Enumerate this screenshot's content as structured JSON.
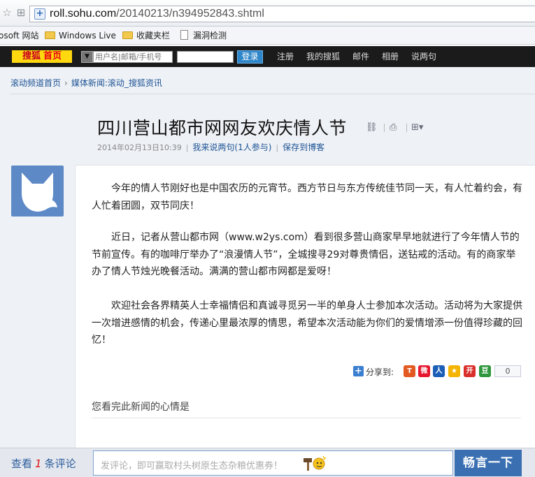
{
  "browser": {
    "url_host": "roll.sohu.com",
    "url_path": "/20140213/n394952843.shtml"
  },
  "favorites": [
    {
      "label": "osoft 网站",
      "icon": "none"
    },
    {
      "label": "Windows Live",
      "icon": "folder-icon"
    },
    {
      "label": "收藏夹栏",
      "icon": "folder-icon"
    },
    {
      "label": "漏洞检测",
      "icon": "document-icon"
    }
  ],
  "topbar": {
    "logo": "搜狐",
    "logo_home": "首页",
    "username_placeholder": "用户名|邮箱/手机号",
    "login_label": "登录",
    "links": [
      "注册",
      "我的搜狐",
      "邮件",
      "相册",
      "说两句"
    ]
  },
  "breadcrumb": {
    "home": "滚动频道首页",
    "current": "媒体新闻:滚动_搜狐资讯"
  },
  "article": {
    "title": "四川营山都市网网友欢庆情人节",
    "datetime": "2014年02月13日10:39",
    "comment_link": "我来说两句(1人参与)",
    "save_link": "保存到博客",
    "paragraphs": [
      "今年的情人节刚好也是中国农历的元宵节。西方节日与东方传统佳节同一天，有人忙着约会，有人忙着团圆，双节同庆！",
      "近日，记者从营山都市网（www.w2ys.com）看到很多营山商家早早地就进行了今年情人节的节前宣传。有的咖啡厅举办了“浪漫情人节”，全城搜寻29对尊贵情侣，送钻戒的活动。有的商家举办了情人节烛光晚餐活动。满满的营山都市网都是爱呀！",
      "欢迎社会各界精英人士幸福情侣和真诚寻觅另一半的单身人士参加本次活动。活动将为大家提供一次增进感情的机会，传递心里最浓厚的情思，希望本次活动能为你们的爱情增添一份值得珍藏的回忆！"
    ]
  },
  "share": {
    "label": "分享到:",
    "services": [
      {
        "name": "tencent-weibo",
        "glyph": "T",
        "color": "#e25a21"
      },
      {
        "name": "sina-weibo",
        "glyph": "微",
        "color": "#e6162d"
      },
      {
        "name": "renren",
        "glyph": "人",
        "color": "#1b5fb7"
      },
      {
        "name": "qzone",
        "glyph": "★",
        "color": "#f4b400"
      },
      {
        "name": "kaixin",
        "glyph": "开",
        "color": "#d9302b"
      },
      {
        "name": "douban",
        "glyph": "豆",
        "color": "#2e963d"
      }
    ],
    "count": "0"
  },
  "mood": {
    "label": "您看完此新闻的心情是"
  },
  "comment_bar": {
    "prefix": "查看",
    "count": "1",
    "suffix": "条评论",
    "placeholder": "发评论，即可赢取村头树原生态杂粮优惠券！",
    "submit": "畅言一下"
  }
}
